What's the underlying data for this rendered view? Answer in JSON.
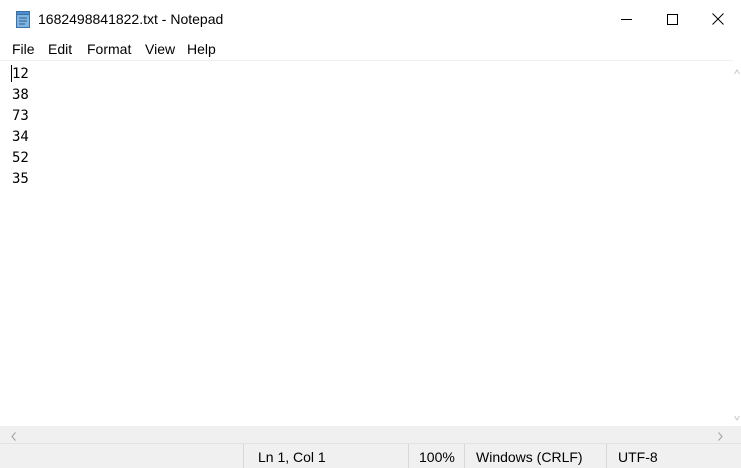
{
  "window": {
    "title": "1682498841822.txt - Notepad",
    "icon": "notepad-icon"
  },
  "window_controls": {
    "minimize_icon": "minimize-icon",
    "maximize_icon": "maximize-icon",
    "close_icon": "close-icon"
  },
  "menu": {
    "items": [
      "File",
      "Edit",
      "Format",
      "View",
      "Help"
    ]
  },
  "editor": {
    "lines": [
      "12",
      "38",
      "73",
      "34",
      "52",
      "35"
    ]
  },
  "status_bar": {
    "position": "Ln 1, Col 1",
    "zoom": "100%",
    "line_ending": "Windows (CRLF)",
    "encoding": "UTF-8"
  },
  "colors": {
    "background": "#ffffff",
    "status_bar_bg": "#f0f0f0",
    "text": "#000000"
  }
}
